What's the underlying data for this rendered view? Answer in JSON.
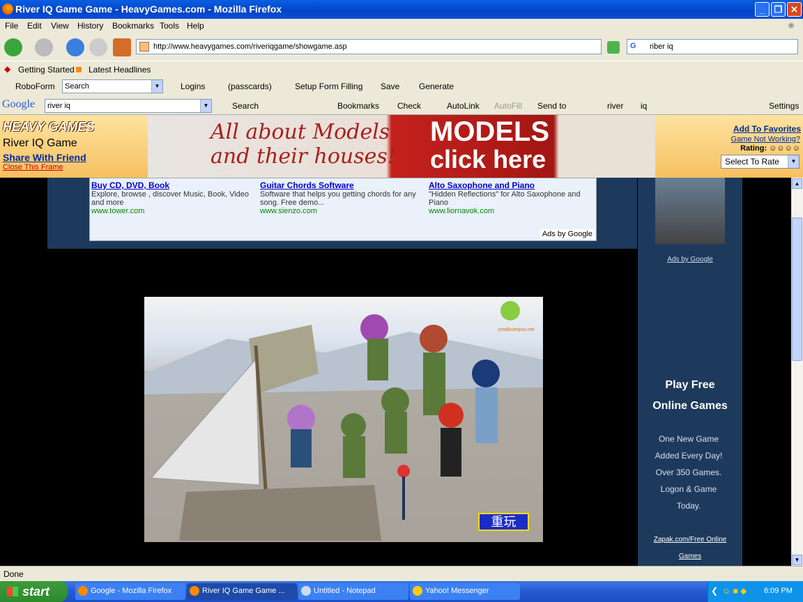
{
  "window": {
    "title": "River IQ Game Game - HeavyGames.com - Mozilla Firefox"
  },
  "menu": [
    "File",
    "Edit",
    "View",
    "History",
    "Bookmarks",
    "Tools",
    "Help"
  ],
  "nav": {
    "url": "http://www.heavygames.com/riveriqgame/showgame.asp",
    "search_value": "riber iq"
  },
  "bookmarks": [
    "Getting Started",
    "Latest Headlines"
  ],
  "roboform": {
    "label": "RoboForm",
    "search": "Search",
    "logins": "Logins",
    "passcards": "(passcards)",
    "setup": "Setup Form Filling",
    "save": "Save",
    "generate": "Generate"
  },
  "google_bar": {
    "logo": "Google",
    "query": "river iq",
    "search": "Search",
    "bookmarks": "Bookmarks",
    "check": "Check",
    "autolink": "AutoLink",
    "autofill": "AutoFill",
    "sendto": "Send to",
    "term1": "river",
    "term2": "iq",
    "settings": "Settings"
  },
  "hg": {
    "logo": "HEAVY GAMES",
    "game_title": "River IQ Game",
    "share": "Share With Friend",
    "close": "Close This Frame",
    "add_fav": "Add To Favorites",
    "not_working": "Game Not Working?",
    "rating": "Rating:",
    "rate_select": "Select To Rate"
  },
  "banner": {
    "line1": "All about Models",
    "line2": "and their houses!",
    "m1": "MODELS",
    "m2": "click here"
  },
  "ads": [
    {
      "title": "Buy CD, DVD, Book",
      "desc": "Explore, browse , discover Music, Book, Video and more",
      "url": "www.tower.com"
    },
    {
      "title": "Guitar Chords Software",
      "desc": "Software that helps you getting chords for any song. Free demo...",
      "url": "www.sienzo.com"
    },
    {
      "title": "Alto Saxophone and Piano",
      "desc": "\"Hidden Reflections\" for Alto Saxophone and Piano",
      "url": "www.liornavok.com"
    }
  ],
  "ads_by": "Ads by Google",
  "game": {
    "replay": "重玩",
    "brand": "smallcompus.net"
  },
  "sidebar": {
    "ads_link": "Ads by Google",
    "play_title": [
      "Play Free",
      "Online Games"
    ],
    "promo": [
      "One New Game",
      "Added Every Day!",
      "Over 350 Games.",
      "Logon & Game",
      "Today."
    ],
    "zapak": [
      "Zapak.com/Free Online",
      "Games"
    ]
  },
  "status": "Done",
  "taskbar": {
    "start": "start",
    "tasks": [
      "Google - Mozilla Firefox",
      "River IQ Game Game ...",
      "Untitled - Notepad",
      "Yahoo! Messenger"
    ],
    "clock": "6:09 PM"
  }
}
